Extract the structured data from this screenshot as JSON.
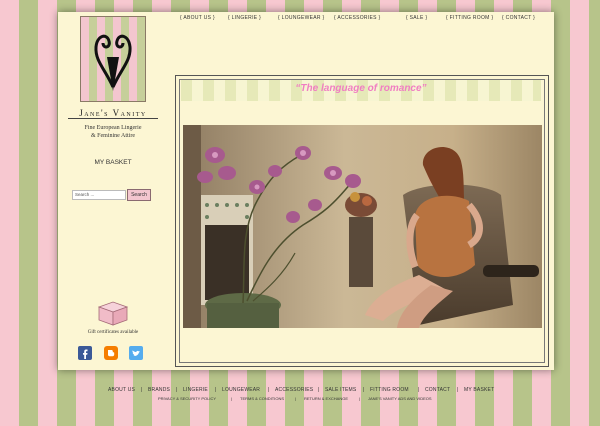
{
  "brand": {
    "name": "Jane's Vanity",
    "tagline_1": "Fine European Lingerie",
    "tagline_2": "& Feminine Attire"
  },
  "sidebar": {
    "basket": "MY BASKET",
    "search": {
      "placeholder": "Search ...",
      "button": "Search"
    },
    "gift_label": "Gift certificates available"
  },
  "topnav": [
    "{ ABOUT US }",
    "{ LINGERIE }",
    "{ LOUNGEWEAR }",
    "{ ACCESSORIES }",
    "{ SALE }",
    "{ FITTING ROOM }",
    "{ CONTACT }"
  ],
  "content": {
    "slogan": "“The language of romance”"
  },
  "footer": {
    "primary": [
      "ABOUT US",
      "BRANDS",
      "LINGERIE",
      "LOUNGEWEAR",
      "ACCESSORIES",
      "SALE ITEMS",
      "FITTING ROOM",
      "CONTACT",
      "MY BASKET"
    ],
    "secondary": [
      "PRIVACY & SECURITY POLICY",
      "TERMS & CONDITIONS",
      "RETURN & EXCHANGE",
      "JANE'S VANITY ADS AND VIDEOS"
    ],
    "separator": "|"
  },
  "icons": {
    "logo": "vanity-monogram-icon",
    "gift": "gift-box-icon",
    "social": [
      "facebook-icon",
      "blogger-icon",
      "twitter-icon"
    ]
  },
  "colors": {
    "pink_stripe": "#f7c8d0",
    "green_stripe": "#b7c48a",
    "panel": "#fcf6d3",
    "slogan": "#f07ec2",
    "facebook": "#3b5998",
    "blogger": "#f57d00",
    "twitter": "#55acee"
  }
}
